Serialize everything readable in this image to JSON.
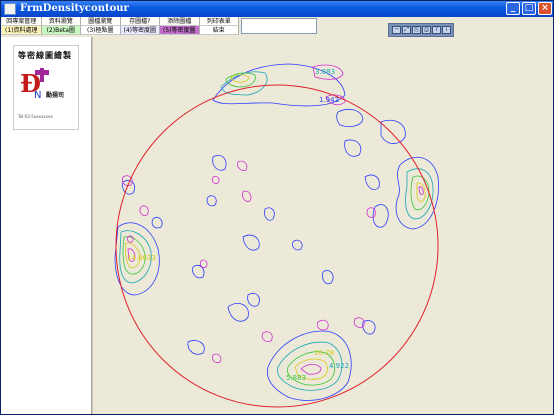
{
  "window": {
    "title": "FrmDensitycontour",
    "controls": {
      "minimize": "_",
      "maximize": "□",
      "close": "×"
    }
  },
  "menu": {
    "row1": [
      "回專案管理",
      "資料瀏覽",
      "圖檔瀏覽",
      "存圖檔?",
      "添除圖檔",
      "列印表單"
    ],
    "row2": [
      "(1)資料處理",
      "(2)Beta圖",
      "(3)極點圖",
      "(4)等密度圖",
      "(5)等密度圖",
      "結束"
    ],
    "row2_colors": [
      "#fff4b8",
      "#c9f7c0",
      "#ffffff",
      "#e9e9ff",
      "#c070c8",
      "#ffffff"
    ]
  },
  "toolbar": {
    "icons": [
      "line-icon",
      "zoom-icon",
      "copy-icon",
      "print-icon",
      "help-icon",
      "info-icon"
    ],
    "glyphs": [
      "─",
      "⤢",
      "⎘",
      "⎙",
      "?",
      "i"
    ]
  },
  "logo": {
    "title": "等密線圖繪製",
    "company": "勵揚司",
    "small_text": "Tel:03-5xxxxxxxx"
  },
  "contour": {
    "circle_color": "#e0202a",
    "labels": [
      "3.883",
      "1.942",
      "14.0633",
      "10.78",
      "5.883",
      "4.922"
    ]
  }
}
